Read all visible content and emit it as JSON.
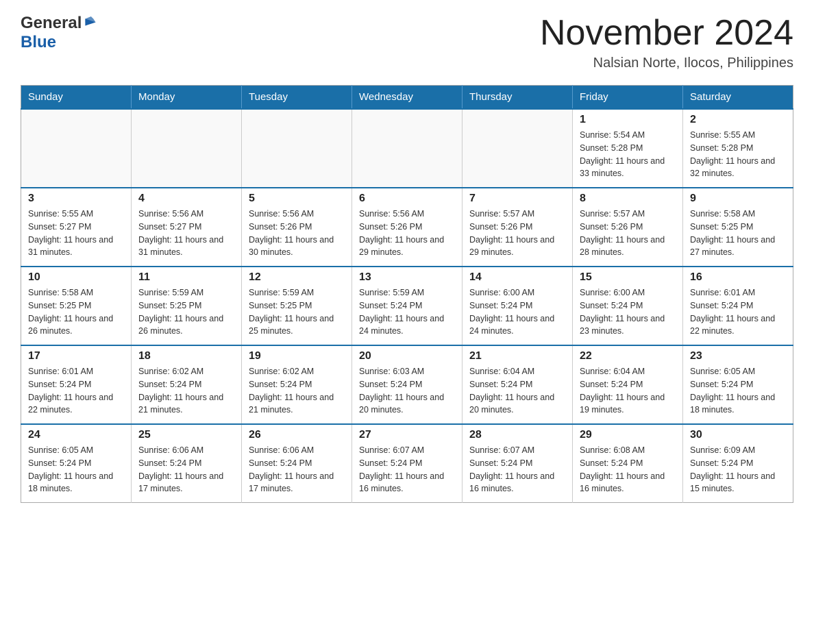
{
  "header": {
    "logo_general": "General",
    "logo_blue": "Blue",
    "month_title": "November 2024",
    "location": "Nalsian Norte, Ilocos, Philippines"
  },
  "calendar": {
    "days_of_week": [
      "Sunday",
      "Monday",
      "Tuesday",
      "Wednesday",
      "Thursday",
      "Friday",
      "Saturday"
    ],
    "weeks": [
      [
        {
          "day": "",
          "info": ""
        },
        {
          "day": "",
          "info": ""
        },
        {
          "day": "",
          "info": ""
        },
        {
          "day": "",
          "info": ""
        },
        {
          "day": "",
          "info": ""
        },
        {
          "day": "1",
          "info": "Sunrise: 5:54 AM\nSunset: 5:28 PM\nDaylight: 11 hours and 33 minutes."
        },
        {
          "day": "2",
          "info": "Sunrise: 5:55 AM\nSunset: 5:28 PM\nDaylight: 11 hours and 32 minutes."
        }
      ],
      [
        {
          "day": "3",
          "info": "Sunrise: 5:55 AM\nSunset: 5:27 PM\nDaylight: 11 hours and 31 minutes."
        },
        {
          "day": "4",
          "info": "Sunrise: 5:56 AM\nSunset: 5:27 PM\nDaylight: 11 hours and 31 minutes."
        },
        {
          "day": "5",
          "info": "Sunrise: 5:56 AM\nSunset: 5:26 PM\nDaylight: 11 hours and 30 minutes."
        },
        {
          "day": "6",
          "info": "Sunrise: 5:56 AM\nSunset: 5:26 PM\nDaylight: 11 hours and 29 minutes."
        },
        {
          "day": "7",
          "info": "Sunrise: 5:57 AM\nSunset: 5:26 PM\nDaylight: 11 hours and 29 minutes."
        },
        {
          "day": "8",
          "info": "Sunrise: 5:57 AM\nSunset: 5:26 PM\nDaylight: 11 hours and 28 minutes."
        },
        {
          "day": "9",
          "info": "Sunrise: 5:58 AM\nSunset: 5:25 PM\nDaylight: 11 hours and 27 minutes."
        }
      ],
      [
        {
          "day": "10",
          "info": "Sunrise: 5:58 AM\nSunset: 5:25 PM\nDaylight: 11 hours and 26 minutes."
        },
        {
          "day": "11",
          "info": "Sunrise: 5:59 AM\nSunset: 5:25 PM\nDaylight: 11 hours and 26 minutes."
        },
        {
          "day": "12",
          "info": "Sunrise: 5:59 AM\nSunset: 5:25 PM\nDaylight: 11 hours and 25 minutes."
        },
        {
          "day": "13",
          "info": "Sunrise: 5:59 AM\nSunset: 5:24 PM\nDaylight: 11 hours and 24 minutes."
        },
        {
          "day": "14",
          "info": "Sunrise: 6:00 AM\nSunset: 5:24 PM\nDaylight: 11 hours and 24 minutes."
        },
        {
          "day": "15",
          "info": "Sunrise: 6:00 AM\nSunset: 5:24 PM\nDaylight: 11 hours and 23 minutes."
        },
        {
          "day": "16",
          "info": "Sunrise: 6:01 AM\nSunset: 5:24 PM\nDaylight: 11 hours and 22 minutes."
        }
      ],
      [
        {
          "day": "17",
          "info": "Sunrise: 6:01 AM\nSunset: 5:24 PM\nDaylight: 11 hours and 22 minutes."
        },
        {
          "day": "18",
          "info": "Sunrise: 6:02 AM\nSunset: 5:24 PM\nDaylight: 11 hours and 21 minutes."
        },
        {
          "day": "19",
          "info": "Sunrise: 6:02 AM\nSunset: 5:24 PM\nDaylight: 11 hours and 21 minutes."
        },
        {
          "day": "20",
          "info": "Sunrise: 6:03 AM\nSunset: 5:24 PM\nDaylight: 11 hours and 20 minutes."
        },
        {
          "day": "21",
          "info": "Sunrise: 6:04 AM\nSunset: 5:24 PM\nDaylight: 11 hours and 20 minutes."
        },
        {
          "day": "22",
          "info": "Sunrise: 6:04 AM\nSunset: 5:24 PM\nDaylight: 11 hours and 19 minutes."
        },
        {
          "day": "23",
          "info": "Sunrise: 6:05 AM\nSunset: 5:24 PM\nDaylight: 11 hours and 18 minutes."
        }
      ],
      [
        {
          "day": "24",
          "info": "Sunrise: 6:05 AM\nSunset: 5:24 PM\nDaylight: 11 hours and 18 minutes."
        },
        {
          "day": "25",
          "info": "Sunrise: 6:06 AM\nSunset: 5:24 PM\nDaylight: 11 hours and 17 minutes."
        },
        {
          "day": "26",
          "info": "Sunrise: 6:06 AM\nSunset: 5:24 PM\nDaylight: 11 hours and 17 minutes."
        },
        {
          "day": "27",
          "info": "Sunrise: 6:07 AM\nSunset: 5:24 PM\nDaylight: 11 hours and 16 minutes."
        },
        {
          "day": "28",
          "info": "Sunrise: 6:07 AM\nSunset: 5:24 PM\nDaylight: 11 hours and 16 minutes."
        },
        {
          "day": "29",
          "info": "Sunrise: 6:08 AM\nSunset: 5:24 PM\nDaylight: 11 hours and 16 minutes."
        },
        {
          "day": "30",
          "info": "Sunrise: 6:09 AM\nSunset: 5:24 PM\nDaylight: 11 hours and 15 minutes."
        }
      ]
    ]
  }
}
